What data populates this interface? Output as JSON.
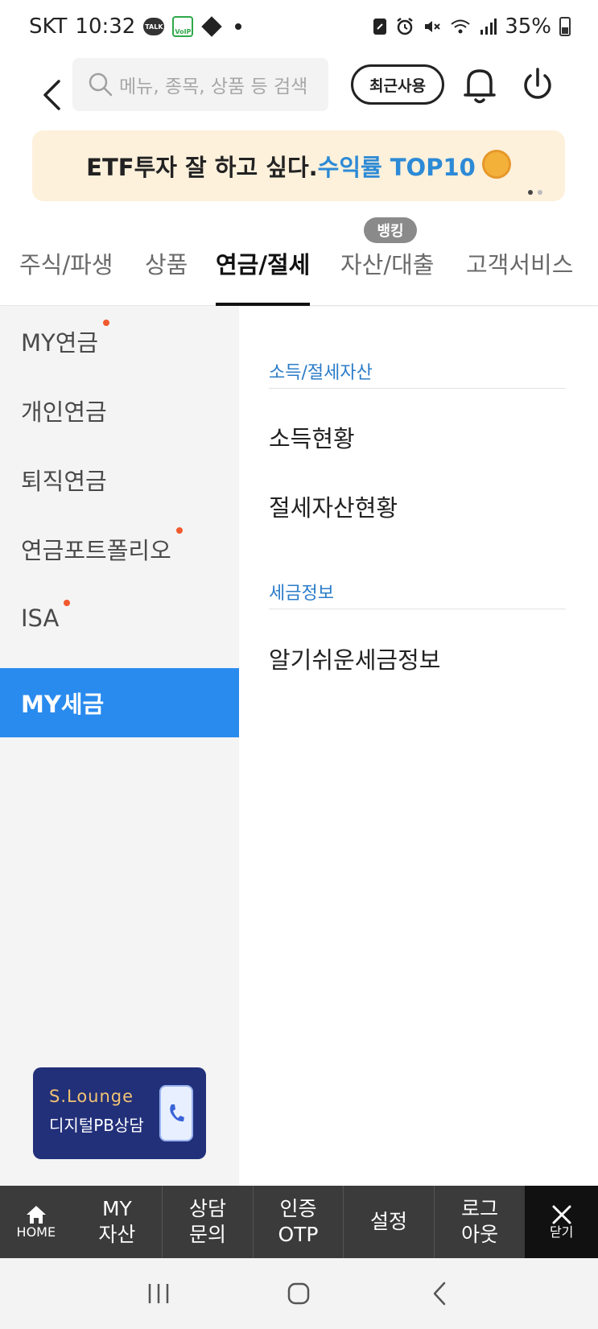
{
  "status_bar": {
    "carrier": "SKT",
    "time": "10:32",
    "battery": "35%",
    "icons": [
      "talk-icon",
      "voip-wifi-icon",
      "diamond-icon",
      "dot-icon",
      "nfc-icon",
      "alarm-icon",
      "mute-icon",
      "wifi-icon",
      "signal-icon",
      "battery-icon"
    ]
  },
  "header": {
    "search_placeholder": "메뉴, 종목, 상품 등 검색",
    "recent_label": "최근사용"
  },
  "banner": {
    "text": "ETF투자 잘 하고 싶다.",
    "highlight": "수익률 TOP10",
    "page_count": 2,
    "current_page": 1,
    "highlight_color": "#2d8ad6"
  },
  "tabs": {
    "badge": "뱅킹",
    "items": [
      "주식/파생",
      "상품",
      "연금/절세",
      "자산/대출",
      "고객서비스"
    ],
    "active_index": 2
  },
  "sidebar": {
    "items": [
      {
        "label": "MY연금",
        "dot": true
      },
      {
        "label": "개인연금",
        "dot": false
      },
      {
        "label": "퇴직연금",
        "dot": false
      },
      {
        "label": "연금포트폴리오",
        "dot": true
      },
      {
        "label": "ISA",
        "dot": true
      },
      {
        "label": "MY세금",
        "dot": false
      }
    ],
    "active_index": 5,
    "active_color": "#2a8bee",
    "dot_color": "#f05a2e",
    "lounge": {
      "brand": "S.Lounge",
      "subtitle": "디지털PB상담"
    }
  },
  "content": {
    "sections": [
      {
        "title": "소득/절세자산",
        "items": [
          "소득현황",
          "절세자산현황"
        ]
      },
      {
        "title": "세금정보",
        "items": [
          "알기쉬운세금정보"
        ]
      }
    ]
  },
  "bottom_nav": {
    "home": "HOME",
    "my_assets": [
      "MY",
      "자산"
    ],
    "consult": [
      "상담",
      "문의"
    ],
    "auth": [
      "인증",
      "OTP"
    ],
    "settings": "설정",
    "logout": [
      "로그",
      "아웃"
    ],
    "close": "닫기"
  }
}
